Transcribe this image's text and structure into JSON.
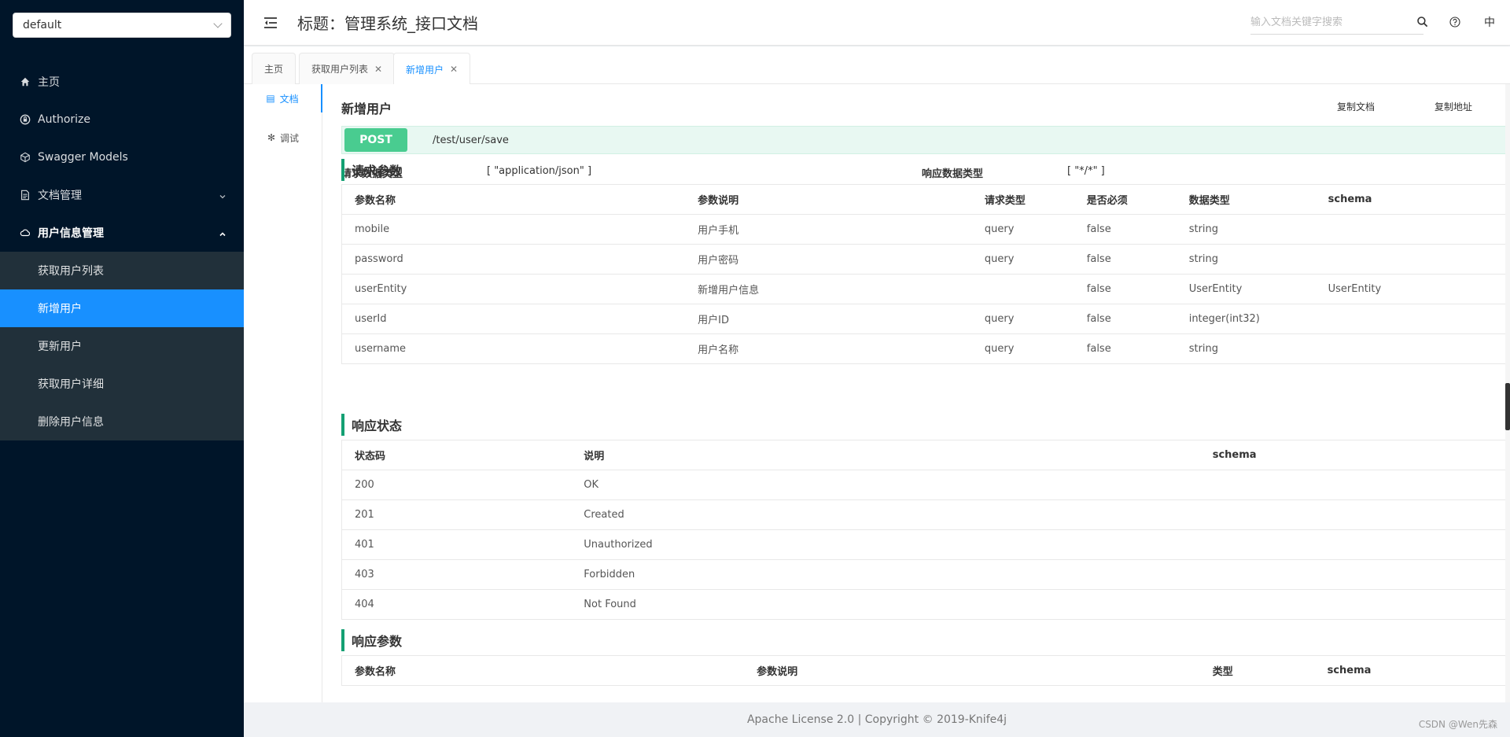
{
  "sidebar": {
    "group_select": "default",
    "menu": [
      {
        "label": "主页",
        "icon": "home-icon"
      },
      {
        "label": "Authorize",
        "icon": "lock-icon"
      },
      {
        "label": "Swagger Models",
        "icon": "cube-icon"
      },
      {
        "label": "文档管理",
        "icon": "file-icon"
      },
      {
        "label": "用户信息管理",
        "icon": "cloud-icon"
      }
    ],
    "submenu": [
      {
        "label": "获取用户列表"
      },
      {
        "label": "新增用户"
      },
      {
        "label": "更新用户"
      },
      {
        "label": "获取用户详细"
      },
      {
        "label": "删除用户信息"
      }
    ]
  },
  "header": {
    "title": "标题：管理系统_接口文档",
    "search_placeholder": "输入文档关键字搜索",
    "lang": "中"
  },
  "tabs": [
    {
      "label": "主页",
      "closable": false
    },
    {
      "label": "获取用户列表",
      "closable": true
    },
    {
      "label": "新增用户",
      "closable": true,
      "active": true
    }
  ],
  "side_tabs": {
    "doc": "文档",
    "debug": "调试"
  },
  "doc": {
    "title": "新增用户",
    "copy_doc": "复制文档",
    "copy_url": "复制地址",
    "method": "POST",
    "path": "/test/user/save",
    "request_type_label": "请求数据类型",
    "request_type_value": "[ \"application/json\" ]",
    "response_type_label": "响应数据类型",
    "response_type_value": "[ \"*/*\" ]",
    "request_params_title": "请求参数",
    "request_params_headers": [
      "参数名称",
      "参数说明",
      "请求类型",
      "是否必须",
      "数据类型",
      "schema"
    ],
    "request_params": [
      {
        "name": "mobile",
        "desc": "用户手机",
        "in": "query",
        "required": "false",
        "type": "string",
        "schema": ""
      },
      {
        "name": "password",
        "desc": "用户密码",
        "in": "query",
        "required": "false",
        "type": "string",
        "schema": ""
      },
      {
        "name": "userEntity",
        "desc": "新增用户信息",
        "in": "",
        "required": "false",
        "type": "UserEntity",
        "schema": "UserEntity"
      },
      {
        "name": "userId",
        "desc": "用户ID",
        "in": "query",
        "required": "false",
        "type": "integer(int32)",
        "schema": ""
      },
      {
        "name": "username",
        "desc": "用户名称",
        "in": "query",
        "required": "false",
        "type": "string",
        "schema": ""
      }
    ],
    "response_status_title": "响应状态",
    "response_status_headers": [
      "状态码",
      "说明",
      "schema"
    ],
    "response_status": [
      {
        "code": "200",
        "desc": "OK"
      },
      {
        "code": "201",
        "desc": "Created"
      },
      {
        "code": "401",
        "desc": "Unauthorized"
      },
      {
        "code": "403",
        "desc": "Forbidden"
      },
      {
        "code": "404",
        "desc": "Not Found"
      }
    ],
    "response_params_title": "响应参数",
    "response_params_headers": [
      "参数名称",
      "参数说明",
      "类型",
      "schema"
    ]
  },
  "footer": "Apache License 2.0 | Copyright © 2019-Knife4j",
  "watermark": "CSDN @Wen先森",
  "colors": {
    "sidebar_bg": "#001529",
    "submenu_bg": "#21303a",
    "accent": "#1890ff",
    "post_green": "#49cc90",
    "section_bar": "#14a073"
  }
}
